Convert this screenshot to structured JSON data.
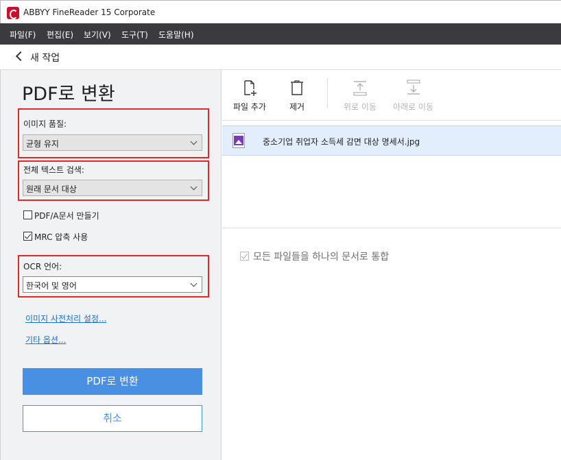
{
  "window": {
    "title": "ABBYY FineReader 15 Corporate",
    "accent": "#c8102e"
  },
  "menu": [
    "파일(F)",
    "편집(E)",
    "보기(V)",
    "도구(T)",
    "도움말(H)"
  ],
  "nav": {
    "title": "새 작업"
  },
  "left_panel": {
    "heading": "PDF로 변환",
    "image_quality": {
      "label": "이미지 품질:",
      "value": "균형 유지"
    },
    "full_text_search": {
      "label": "전체 텍스트 검색:",
      "value": "원래 문서 대상"
    },
    "pdfa_checkbox": {
      "label": "PDF/A문서 만들기",
      "checked": false
    },
    "mrc_checkbox": {
      "label": "MRC 압축 사용",
      "checked": true
    },
    "ocr_language": {
      "label": "OCR 언어:",
      "value": "한국어 및 영어"
    },
    "link_preprocess": "이미지 사전처리 설정...",
    "link_other": "기타 옵션...",
    "convert_button": "PDF로 변환",
    "cancel_button": "취소",
    "highlight_color": "#e0262b",
    "button_color": "#4a90e2"
  },
  "toolbar": {
    "add_file": "파일 추가",
    "remove": "제거",
    "move_up": "위로 이동",
    "move_down": "아래로 이동"
  },
  "files": [
    {
      "name": "중소기업 취업자 소득세 감면 대상 명세서.jpg",
      "icon": "image-file-icon"
    }
  ],
  "merge_option": {
    "label": "모든 파일들을 하나의 문서로 통합",
    "checked": true,
    "enabled": false
  }
}
